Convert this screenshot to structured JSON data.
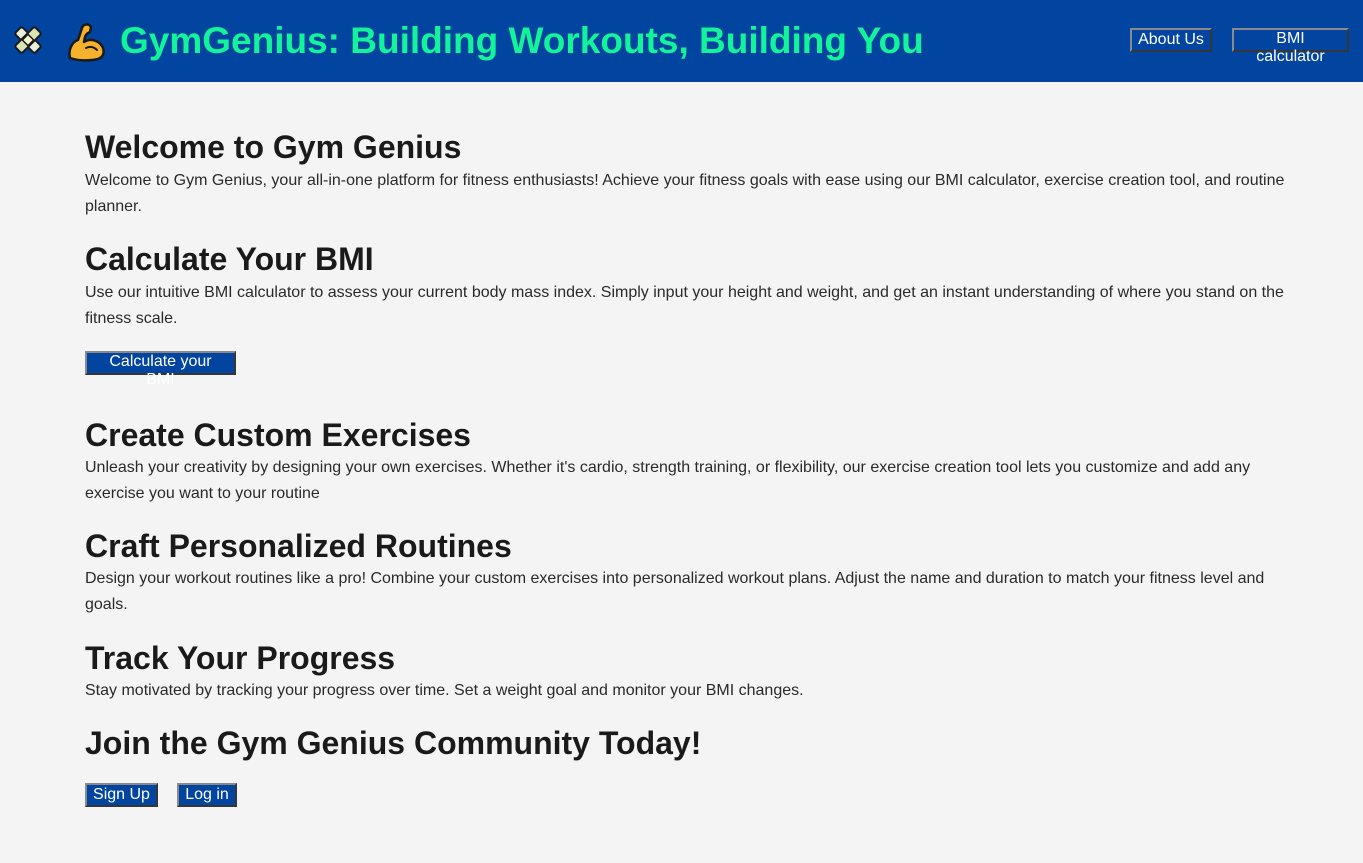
{
  "header": {
    "title": "GymGenius: Building Workouts, Building You",
    "nav": {
      "about_label": "About Us",
      "bmi_label": "BMI calculator"
    },
    "colors": {
      "background": "#0145a0",
      "title": "#13f39a"
    }
  },
  "sections": {
    "welcome": {
      "heading": "Welcome to Gym Genius",
      "text": "Welcome to Gym Genius, your all-in-one platform for fitness enthusiasts! Achieve your fitness goals with ease using our BMI calculator, exercise creation tool, and routine planner."
    },
    "bmi": {
      "heading": "Calculate Your BMI",
      "text": "Use our intuitive BMI calculator to assess your current body mass index. Simply input your height and weight, and get an instant understanding of where you stand on the fitness scale.",
      "button_label": "Calculate your BMI"
    },
    "exercises": {
      "heading": "Create Custom Exercises",
      "text": "Unleash your creativity by designing your own exercises. Whether it's cardio, strength training, or flexibility, our exercise creation tool lets you customize and add any exercise you want to your routine"
    },
    "routines": {
      "heading": "Craft Personalized Routines",
      "text": "Design your workout routines like a pro! Combine your custom exercises into personalized workout plans. Adjust the name and duration to match your fitness level and goals."
    },
    "progress": {
      "heading": "Track Your Progress",
      "text": "Stay motivated by tracking your progress over time. Set a weight goal and monitor your BMI changes."
    },
    "community": {
      "heading": "Join the Gym Genius Community Today!",
      "signup_label": "Sign Up",
      "login_label": "Log in"
    }
  },
  "icons": {
    "logo": "gym-logo-icon",
    "emoji": "flexed-biceps-icon"
  }
}
